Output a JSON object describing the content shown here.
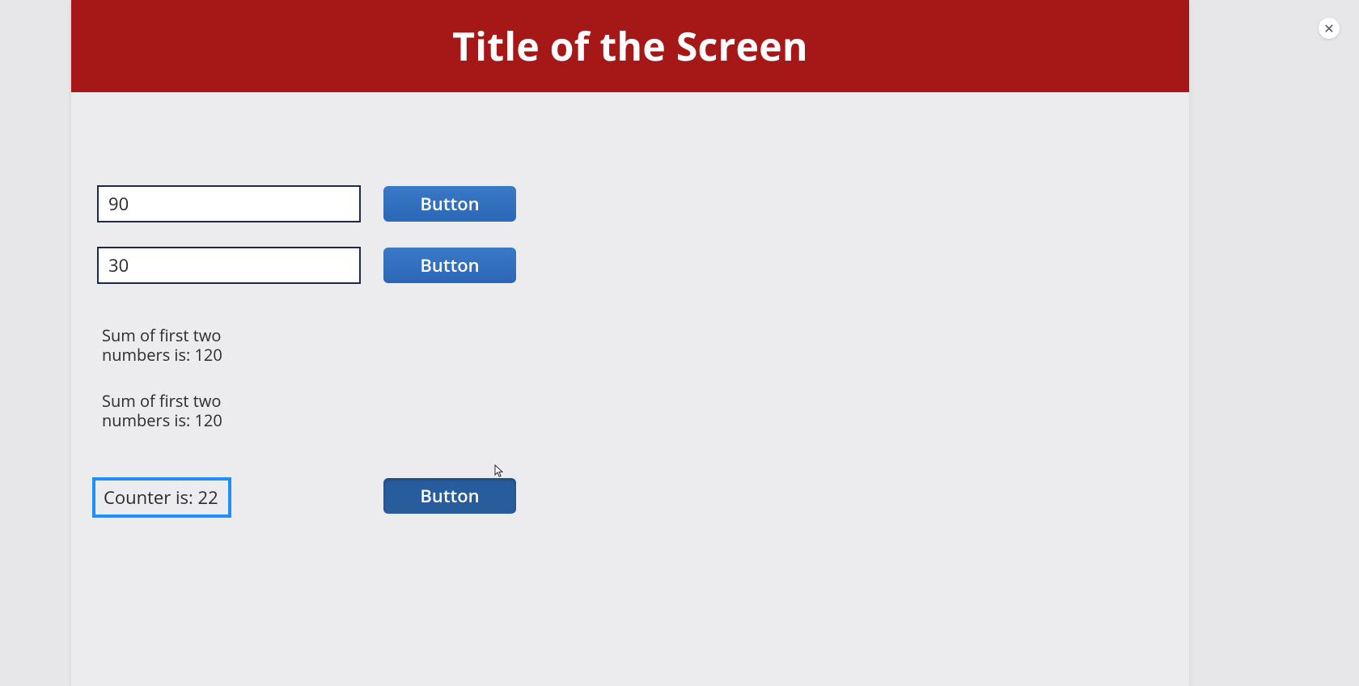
{
  "header": {
    "title": "Title of the Screen"
  },
  "inputs": {
    "field1_value": "90",
    "field2_value": "30"
  },
  "buttons": {
    "btn1_label": "Button",
    "btn2_label": "Button",
    "btn3_label": "Button"
  },
  "results": {
    "sum1_text": "Sum of first two numbers is: 120",
    "sum2_text": "Sum of first two numbers is: 120",
    "counter_text": "Counter is: 22"
  },
  "overlay": {
    "close_glyph": "✕"
  }
}
